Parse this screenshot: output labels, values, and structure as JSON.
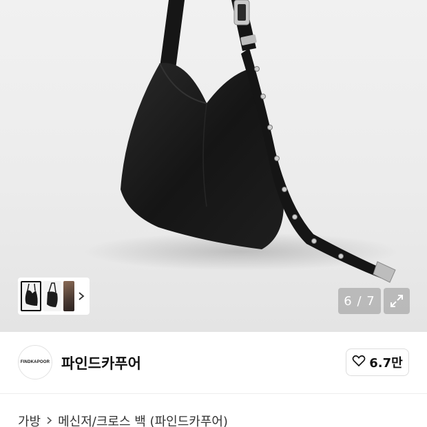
{
  "gallery": {
    "counter": "6 / 7",
    "thumbs": [
      "bag-thumb",
      "bag-side-thumb",
      "model-thumb"
    ]
  },
  "brand": {
    "logo_text": "FINDKAPOOR",
    "name": "파인드카푸어",
    "likes": "6.7만"
  },
  "breadcrumb": {
    "category": "가방",
    "subcategory": "메신저/크로스 백 (파인드카푸어)"
  },
  "colors": {
    "background": "#ececec",
    "bag": "#1a1a1a",
    "buckle": "#b8b8b8"
  }
}
